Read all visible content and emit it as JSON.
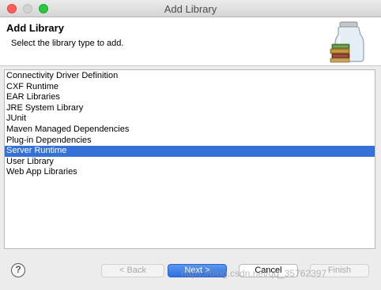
{
  "window": {
    "title": "Add Library"
  },
  "header": {
    "title": "Add Library",
    "description": "Select the library type to add."
  },
  "list": {
    "items": [
      {
        "label": "Connectivity Driver Definition",
        "selected": false
      },
      {
        "label": "CXF Runtime",
        "selected": false
      },
      {
        "label": "EAR Libraries",
        "selected": false
      },
      {
        "label": "JRE System Library",
        "selected": false
      },
      {
        "label": "JUnit",
        "selected": false
      },
      {
        "label": "Maven Managed Dependencies",
        "selected": false
      },
      {
        "label": "Plug-in Dependencies",
        "selected": false
      },
      {
        "label": "Server Runtime",
        "selected": true
      },
      {
        "label": "User Library",
        "selected": false
      },
      {
        "label": "Web App Libraries",
        "selected": false
      }
    ]
  },
  "buttons": {
    "help": "?",
    "back": "< Back",
    "next": "Next >",
    "cancel": "Cancel",
    "finish": "Finish"
  },
  "watermark": "https://blog.csdn.net/qq_35762397",
  "colors": {
    "selection": "#3472d8",
    "default_button": "#2d6fe0",
    "close": "#ff5f57",
    "maximize": "#28c940"
  },
  "icons": {
    "header": "library-jar-icon",
    "help": "help-icon"
  }
}
